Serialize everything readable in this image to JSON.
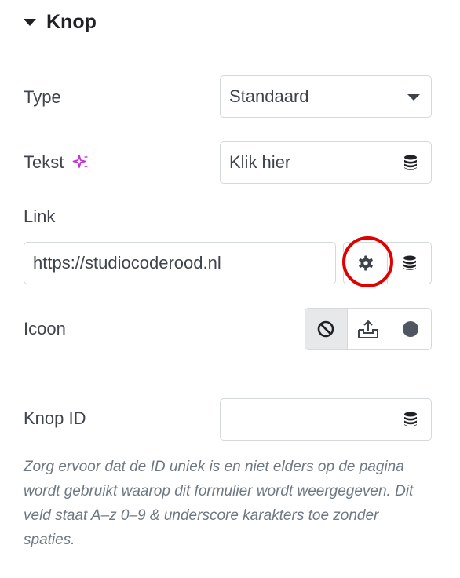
{
  "section": {
    "title": "Knop",
    "expanded": true
  },
  "type_control": {
    "label": "Type",
    "value": "Standaard"
  },
  "text_control": {
    "label": "Tekst",
    "value": "Klik hier",
    "ai_icon": "sparkle-icon",
    "ai_icon_color": "#c036d0"
  },
  "link_control": {
    "label": "Link",
    "value": "https://studiocoderood.nl",
    "settings_icon": "gear-icon",
    "dynamic_icon": "database-icon",
    "highlight_color": "#e00000"
  },
  "icon_control": {
    "label": "Icoon",
    "options": [
      {
        "name": "none",
        "icon": "ban-icon",
        "active": true
      },
      {
        "name": "upload",
        "icon": "upload-icon",
        "active": false
      },
      {
        "name": "circle",
        "icon": "circle-icon",
        "active": false
      }
    ]
  },
  "button_id_control": {
    "label": "Knop ID",
    "value": ""
  },
  "description": "Zorg ervoor dat de ID uniek is en niet elders op de pagina wordt gebruikt waarop dit formulier wordt weergegeven. Dit veld staat A–z  0–9 & underscore karakters toe zonder spaties."
}
